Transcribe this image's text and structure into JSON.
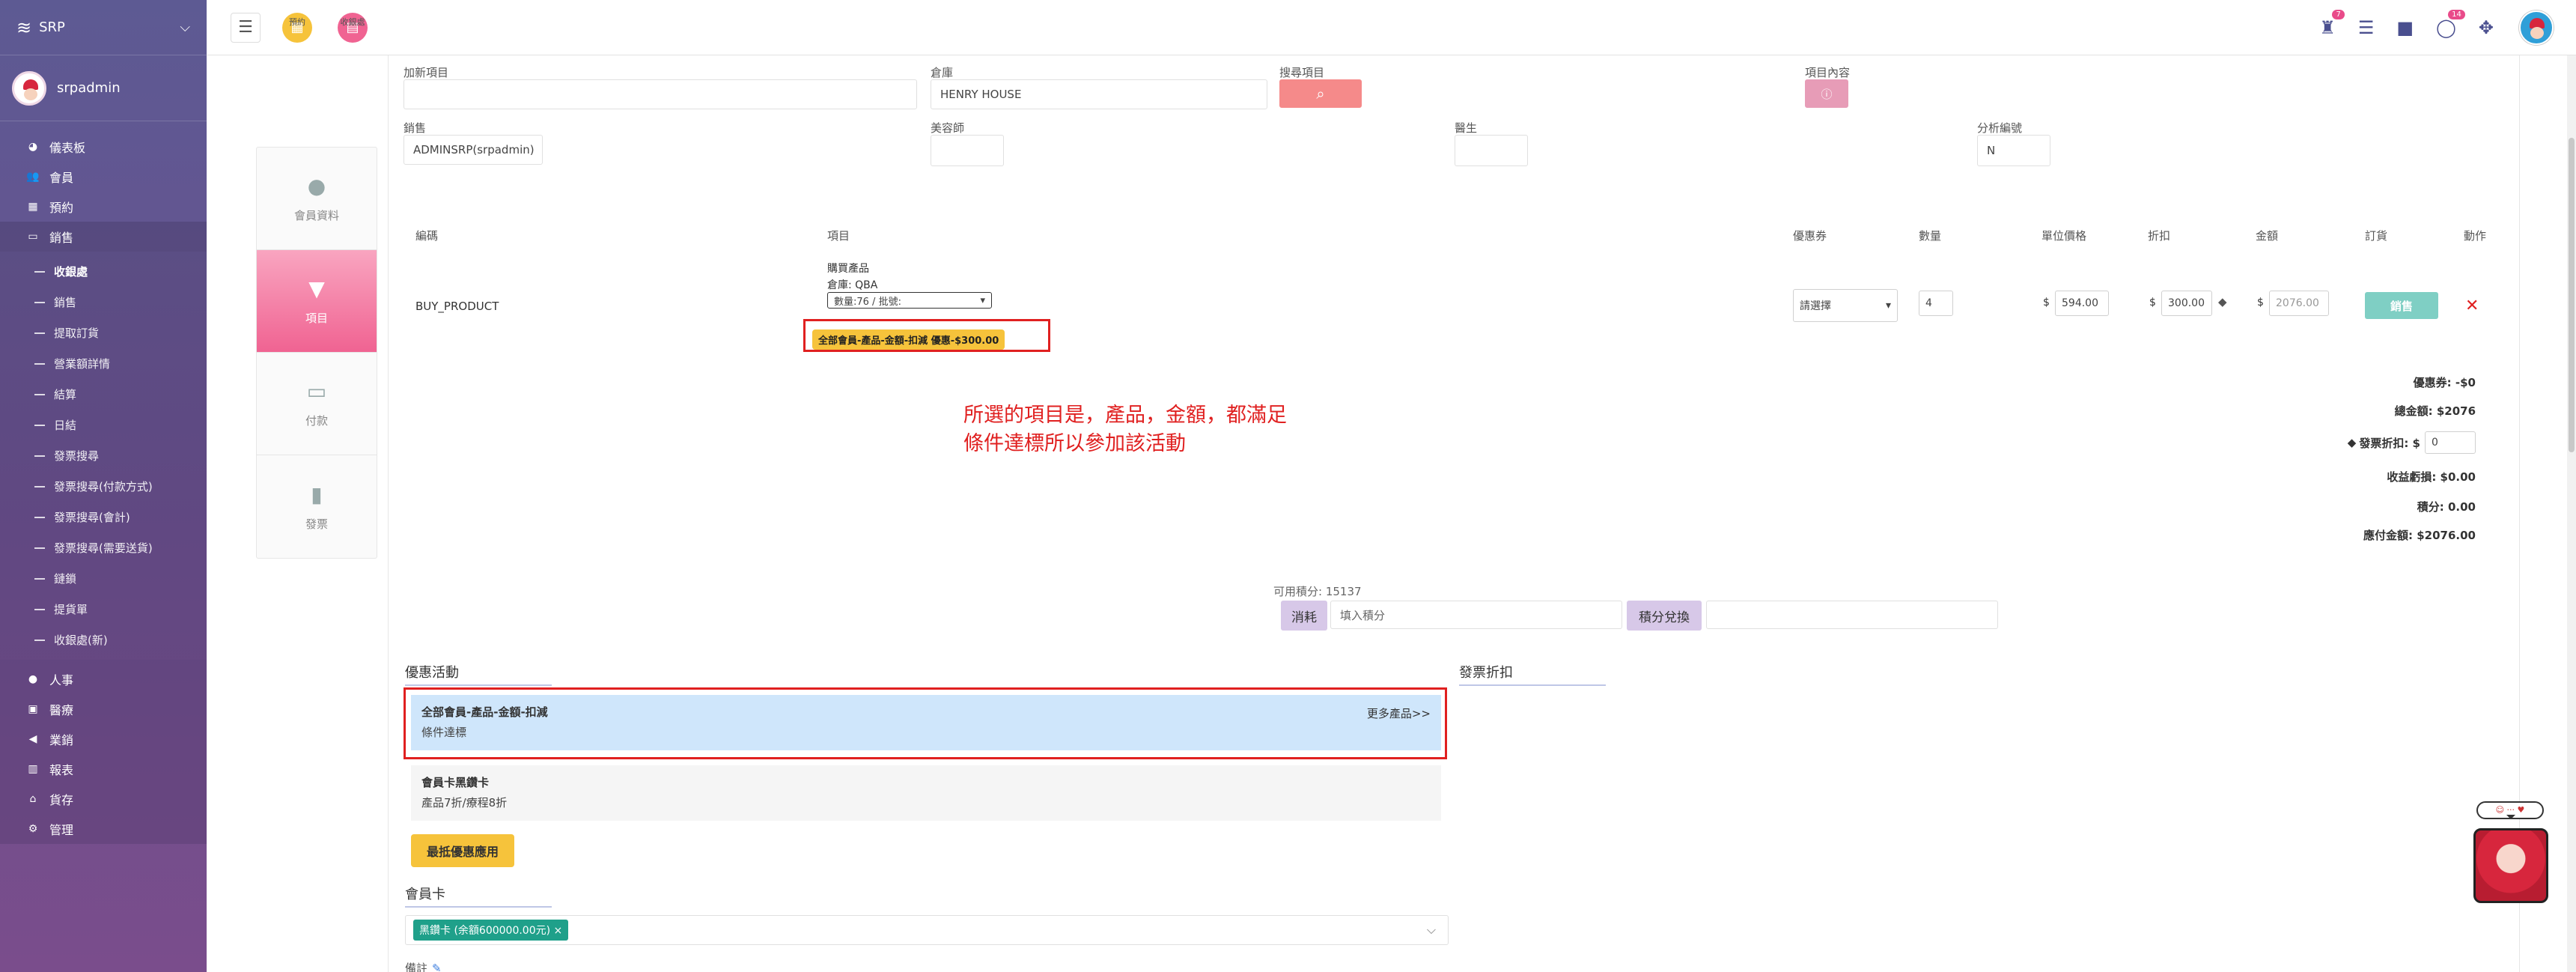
{
  "app": {
    "name": "SRP"
  },
  "sidebar": {
    "username": "srpadmin",
    "items_top": [
      {
        "label": "儀表板",
        "icon": "dashboard-icon",
        "glyph": "◕"
      },
      {
        "label": "會員",
        "icon": "users-icon",
        "glyph": "👥"
      },
      {
        "label": "預約",
        "icon": "calendar-icon",
        "glyph": "▦"
      },
      {
        "label": "銷售",
        "icon": "sales-icon",
        "glyph": "▭"
      }
    ],
    "sub_items": [
      "收銀處",
      "銷售",
      "提取訂貨",
      "營業額詳情",
      "結算",
      "日結",
      "發票搜尋",
      "發票搜尋(付款方式)",
      "發票搜尋(會計)",
      "發票搜尋(需要送貨)",
      "鏈鎖",
      "提貨單",
      "收銀處(新)"
    ],
    "items_bottom": [
      {
        "label": "人事",
        "icon": "person-icon",
        "glyph": "●"
      },
      {
        "label": "醫療",
        "icon": "medical-icon",
        "glyph": "▣"
      },
      {
        "label": "業銷",
        "icon": "megaphone-icon",
        "glyph": "◀"
      },
      {
        "label": "報表",
        "icon": "chart-icon",
        "glyph": "▥"
      },
      {
        "label": "貨存",
        "icon": "warehouse-icon",
        "glyph": "⌂"
      },
      {
        "label": "管理",
        "icon": "gear-icon",
        "glyph": "⚙"
      }
    ]
  },
  "topbar": {
    "appointment_label": "預約",
    "cashier_label": "收銀處",
    "badge_gift": "7",
    "badge_chat": "14"
  },
  "form": {
    "add_item_label": "加新項目",
    "add_item_value": "",
    "warehouse_label": "倉庫",
    "warehouse_value": "HENRY HOUSE",
    "search_label": "搜尋項目",
    "item_content_label": "項目內容",
    "sales_label": "銷售",
    "sales_value": "ADMINSRP(srpadmin)",
    "beautician_label": "美容師",
    "doctor_label": "醫生",
    "analysis_label": "分析編號",
    "analysis_value": "N"
  },
  "table": {
    "headers": {
      "code": "編碼",
      "item": "項目",
      "coupon": "優惠券",
      "qty": "數量",
      "unit_price": "單位價格",
      "discount": "折扣",
      "amount": "金額",
      "order": "訂貨",
      "action": "動作"
    },
    "row": {
      "code": "BUY_PRODUCT",
      "item_type": "購買產品",
      "item_warehouse": "倉庫: QBA",
      "item_select": "數量:76 / 批號:",
      "promo_pill": "全部會員-產品-金額-扣減 優惠-$300.00",
      "coupon_select": "請選擇",
      "qty": "4",
      "unit_price_currency": "$",
      "unit_price": "594.00",
      "discount_currency": "$",
      "discount": "300.00",
      "amount_currency": "$",
      "amount": "2076.00",
      "sale_button": "銷售",
      "delete_glyph": "✕"
    }
  },
  "annotation": {
    "line1": "所選的項目是，產品，金額，都滿足",
    "line2": "條件達標所以參加該活動"
  },
  "summary": {
    "coupon": "優惠券: -$0",
    "total": "總金額: $2076",
    "invoice_discount_label": "發票折扣: $",
    "invoice_discount_value": "0",
    "rounding": "收益虧損: $0.00",
    "points": "積分: 0.00",
    "payable": "應付金額: $2076.00"
  },
  "points": {
    "available": "可用積分: 15137",
    "consume_button": "消耗",
    "input_placeholder": "填入積分",
    "redeem_button": "積分兌換"
  },
  "promotions": {
    "title": "優惠活動",
    "invoice_discount_title": "發票折扣",
    "items": [
      {
        "name": "全部會員-產品-金額-扣減",
        "status": "條件達標",
        "more": "更多產品>>"
      },
      {
        "name": "會員卡黑鑽卡",
        "status": "產品7折/療程8折"
      }
    ],
    "best_button": "最抵優惠應用"
  },
  "member_card": {
    "title": "會員卡",
    "chip": "黑鑽卡 (余額600000.00元)",
    "chip_close": "×"
  },
  "remark_label": "備註",
  "colors": {
    "accent_pink": "#f06392",
    "promo_yellow": "#f6c33b",
    "highlight_blue": "#cfe6fb",
    "annotation_red": "#e02020",
    "chip_teal": "#1fa08a"
  }
}
